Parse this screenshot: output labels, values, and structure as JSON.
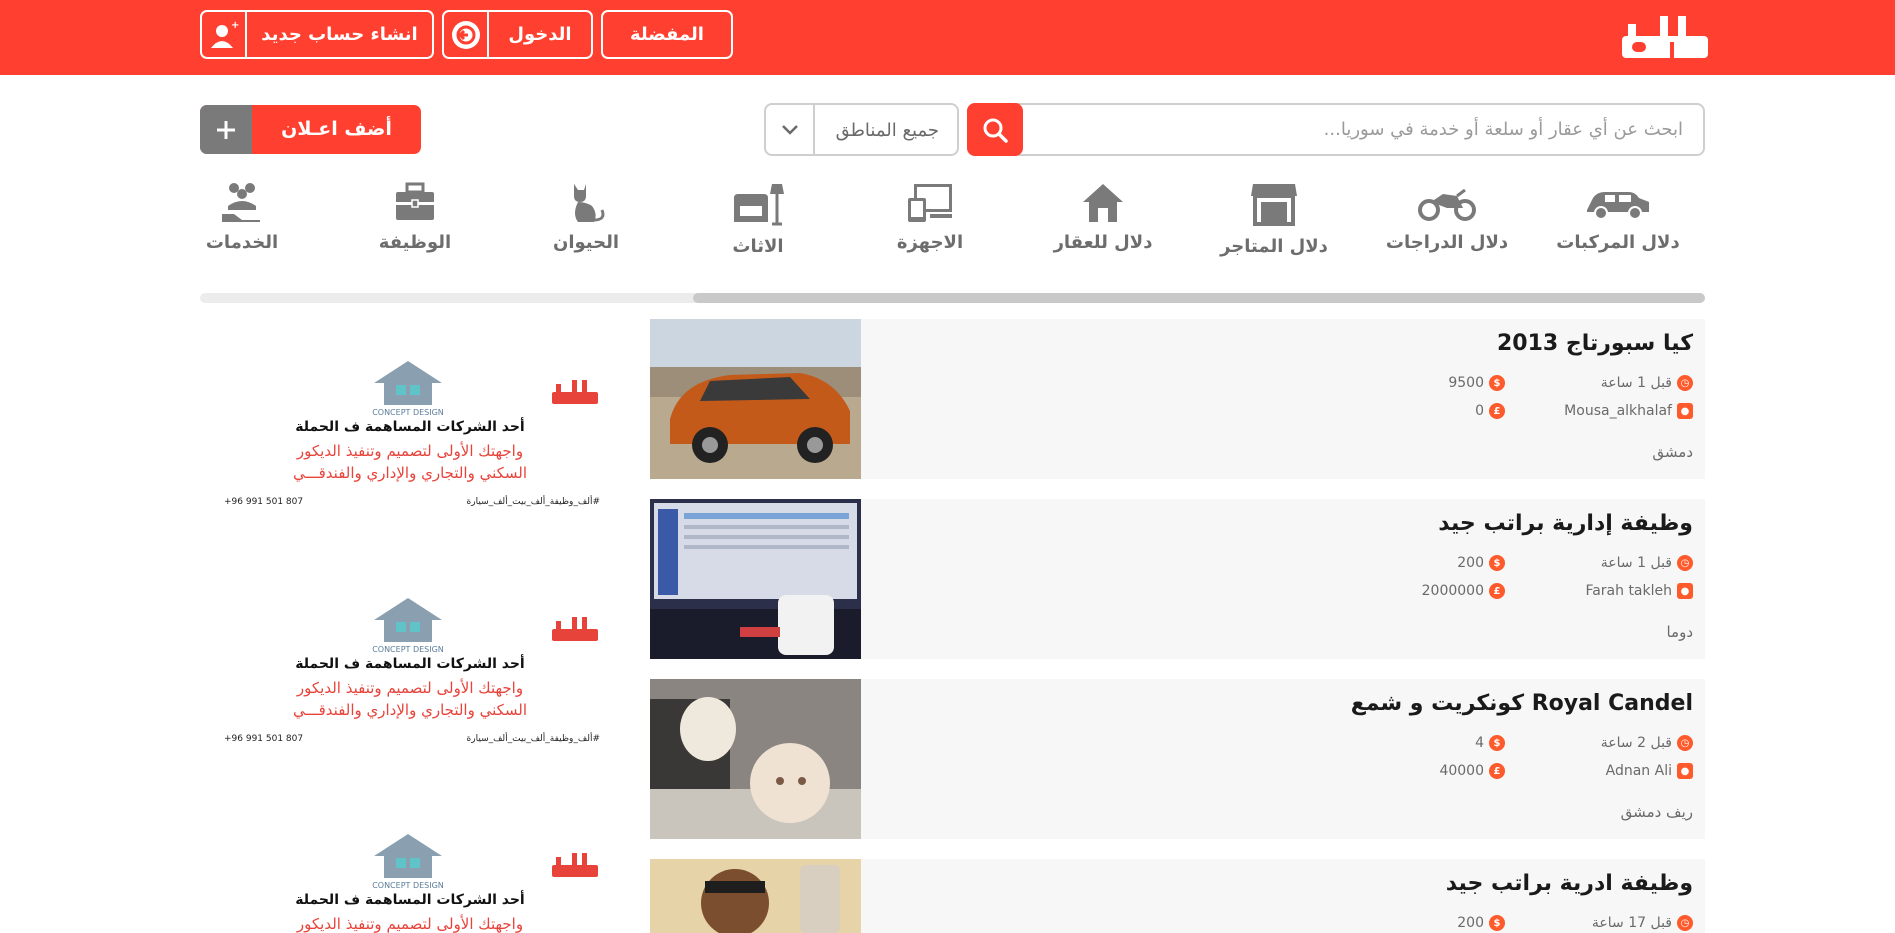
{
  "header": {
    "logo_alt": "دلال",
    "favorites_label": "المفضلة",
    "login_label": "الدخول",
    "signup_label": "انشاء حساب جديد"
  },
  "search": {
    "placeholder": "ابحث عن أي عقار أو سلعة أو خدمة في سوريا...",
    "region_label": "جميع المناطق",
    "add_ad_label": "أضف اعـلان"
  },
  "categories": [
    {
      "label": "دلال المركبات",
      "icon": "car-icon"
    },
    {
      "label": "دلال الدراجات",
      "icon": "motorcycle-icon"
    },
    {
      "label": "دلال المتاجر",
      "icon": "store-icon"
    },
    {
      "label": "دلال للعقار",
      "icon": "house-icon"
    },
    {
      "label": "الاجهزة",
      "icon": "devices-icon"
    },
    {
      "label": "الاثاث",
      "icon": "sofa-lamp-icon"
    },
    {
      "label": "الحيوان",
      "icon": "cat-icon"
    },
    {
      "label": "الوظيفة",
      "icon": "briefcase-icon"
    },
    {
      "label": "الخدمات",
      "icon": "people-hand-icon"
    }
  ],
  "listings": [
    {
      "title": "كيا سبورتاج 2013",
      "time": "قبل 1 ساعة",
      "views": "9500",
      "user": "Mousa_alkhalaf",
      "price": "0",
      "location": "دمشق"
    },
    {
      "title": "وظيفة إدارية براتب جيد",
      "time": "قبل 1 ساعة",
      "views": "200",
      "user": "Farah takleh",
      "price": "2000000",
      "location": "دوما"
    },
    {
      "title": "Royal Candel كونكريت و شمع",
      "time": "قبل 2 ساعة",
      "views": "4",
      "user": "Adnan Ali",
      "price": "40000",
      "location": "ريف دمشق"
    },
    {
      "title": "وظيفة ادرية براتب جيد",
      "time": "قبل 17 ساعة",
      "views": "200",
      "user": "",
      "price": "",
      "location": ""
    }
  ],
  "ad": {
    "brand": "CONCEPT DESIGN",
    "line1": "أحد الشركات المساهمة ف الحملة",
    "line2": "واجهتك الأولى لتصميم وتنفيذ الديكور",
    "line3": "السكني والتجاري والإداري والفندقـــي",
    "phone": "+96 991 501 807",
    "tags": "#ألف_وظيفة_ألف_بيت_ألف_سيارة"
  },
  "colors": {
    "brand": "#ff3f2f",
    "accent": "#ff5a2b"
  }
}
